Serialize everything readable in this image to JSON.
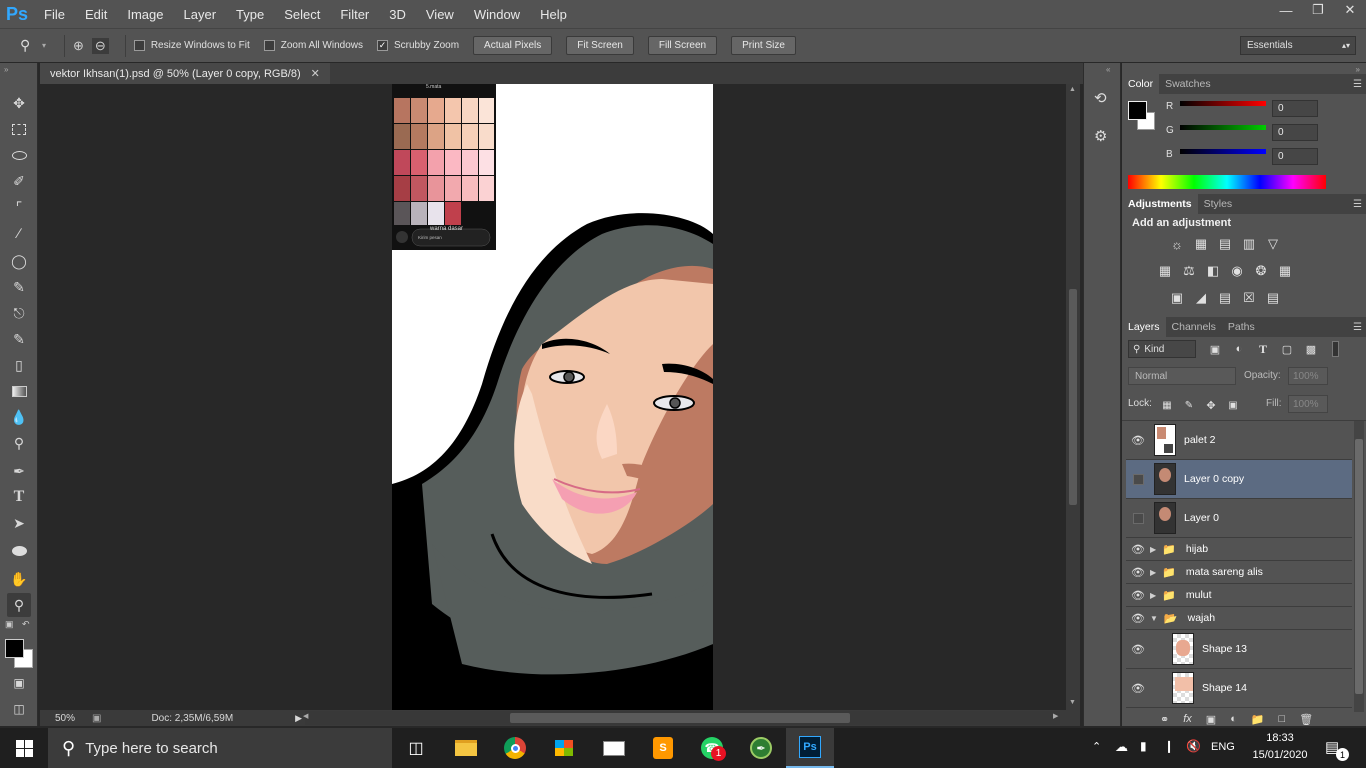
{
  "app": {
    "logo": "Ps"
  },
  "menu": [
    "File",
    "Edit",
    "Image",
    "Layer",
    "Type",
    "Select",
    "Filter",
    "3D",
    "View",
    "Window",
    "Help"
  ],
  "options": {
    "resize_windows": "Resize Windows to Fit",
    "zoom_all": "Zoom All Windows",
    "scrubby_zoom": "Scrubby Zoom",
    "buttons": [
      "Actual Pixels",
      "Fit Screen",
      "Fill Screen",
      "Print Size"
    ],
    "workspace": "Essentials"
  },
  "document": {
    "tab_title": "vektor Ikhsan(1).psd @ 50% (Layer 0 copy, RGB/8)",
    "palette_caption": "warna dasar",
    "palette_top": "5.mata",
    "palette_input": "Kirim pesan"
  },
  "status": {
    "zoom": "50%",
    "doc": "Doc: 2,35M/6,59M"
  },
  "color_panel": {
    "tabs": [
      "Color",
      "Swatches"
    ],
    "channels": [
      {
        "label": "R",
        "value": "0"
      },
      {
        "label": "G",
        "value": "0"
      },
      {
        "label": "B",
        "value": "0"
      }
    ]
  },
  "adjustments_panel": {
    "tabs": [
      "Adjustments",
      "Styles"
    ],
    "heading": "Add an adjustment"
  },
  "layers_panel": {
    "tabs": [
      "Layers",
      "Channels",
      "Paths"
    ],
    "filter": "Kind",
    "blend_mode": "Normal",
    "opacity_label": "Opacity:",
    "opacity_value": "100%",
    "lock_label": "Lock:",
    "fill_label": "Fill:",
    "fill_value": "100%",
    "layers": [
      {
        "name": "palet 2",
        "type": "smart",
        "visible": true,
        "selected": false
      },
      {
        "name": "Layer 0 copy",
        "type": "image",
        "visible": false,
        "selected": true
      },
      {
        "name": "Layer 0",
        "type": "image",
        "visible": false,
        "selected": false
      },
      {
        "name": "hijab",
        "type": "group",
        "visible": true,
        "selected": false
      },
      {
        "name": "mata sareng alis",
        "type": "group",
        "visible": true,
        "selected": false
      },
      {
        "name": "mulut",
        "type": "group",
        "visible": true,
        "selected": false
      },
      {
        "name": "wajah",
        "type": "group-open",
        "visible": true,
        "selected": false
      },
      {
        "name": "Shape 13",
        "type": "shape",
        "visible": true,
        "selected": false
      },
      {
        "name": "Shape 14",
        "type": "shape",
        "visible": true,
        "selected": false
      }
    ]
  },
  "taskbar": {
    "search_placeholder": "Type here to search",
    "whatsapp_badge": "1",
    "language": "ENG",
    "time": "18:33",
    "date": "15/01/2020",
    "notification_count": "1"
  },
  "colors": {
    "accent": "#31a8ff",
    "selected_layer": "#5c6b82",
    "panel": "#535353"
  }
}
